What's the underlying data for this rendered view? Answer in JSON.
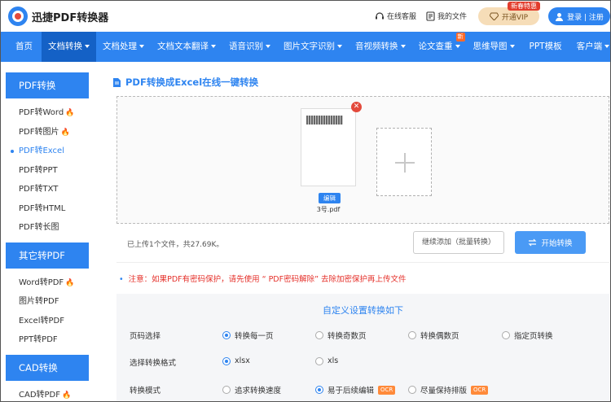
{
  "header": {
    "brand": "迅捷PDF转换器",
    "service": "在线客服",
    "my_files": "我的文件",
    "vip_badge": "新春特惠",
    "vip_label": "开通VIP",
    "login_label": "登录 | 注册"
  },
  "nav": [
    {
      "label": "首页",
      "caret": false
    },
    {
      "label": "文档转换",
      "caret": true
    },
    {
      "label": "文档处理",
      "caret": true
    },
    {
      "label": "文档文本翻译",
      "caret": true
    },
    {
      "label": "语音识别",
      "caret": true
    },
    {
      "label": "图片文字识别",
      "caret": true
    },
    {
      "label": "音视频转换",
      "caret": true
    },
    {
      "label": "论文查重",
      "caret": true,
      "badge": "新"
    },
    {
      "label": "思维导图",
      "caret": true
    },
    {
      "label": "PPT模板",
      "caret": false
    },
    {
      "label": "客户端",
      "caret": true
    }
  ],
  "sidebar": {
    "sections": [
      {
        "title": "PDF转换",
        "items": [
          "PDF转Word",
          "PDF转图片",
          "PDF转Excel",
          "PDF转PPT",
          "PDF转TXT",
          "PDF转HTML",
          "PDF转长图"
        ]
      },
      {
        "title": "其它转PDF",
        "items": [
          "Word转PDF",
          "图片转PDF",
          "Excel转PDF",
          "PPT转PDF"
        ]
      },
      {
        "title": "CAD转换",
        "items": [
          "CAD转PDF"
        ]
      }
    ]
  },
  "main": {
    "title": "PDF转换成Excel在线一键转换",
    "file": {
      "edit_label": "编辑",
      "name": "3号.pdf"
    },
    "upload_info": "已上传1个文件，共27.69K。",
    "continue_label": "继续添加（批量转换）",
    "start_label": "开始转换",
    "notice": "注意：如果PDF有密码保护，请先使用 “ PDF密码解除” 去除加密保护再上传文件",
    "settings": {
      "title": "自定义设置转换如下",
      "page_label": "页码选择",
      "page_options": [
        "转换每一页",
        "转换奇数页",
        "转换偶数页",
        "指定页转换"
      ],
      "format_label": "选择转换格式",
      "format_options": [
        "xlsx",
        "xls"
      ],
      "mode_label": "转换模式",
      "mode_options": [
        "追求转换速度",
        "易于后续编辑",
        "尽量保持排版"
      ],
      "ocr": "OCR"
    }
  },
  "colors": {
    "accent": "#2e84f0",
    "nav_active": "#1461c6",
    "warning": "#e5302a"
  }
}
